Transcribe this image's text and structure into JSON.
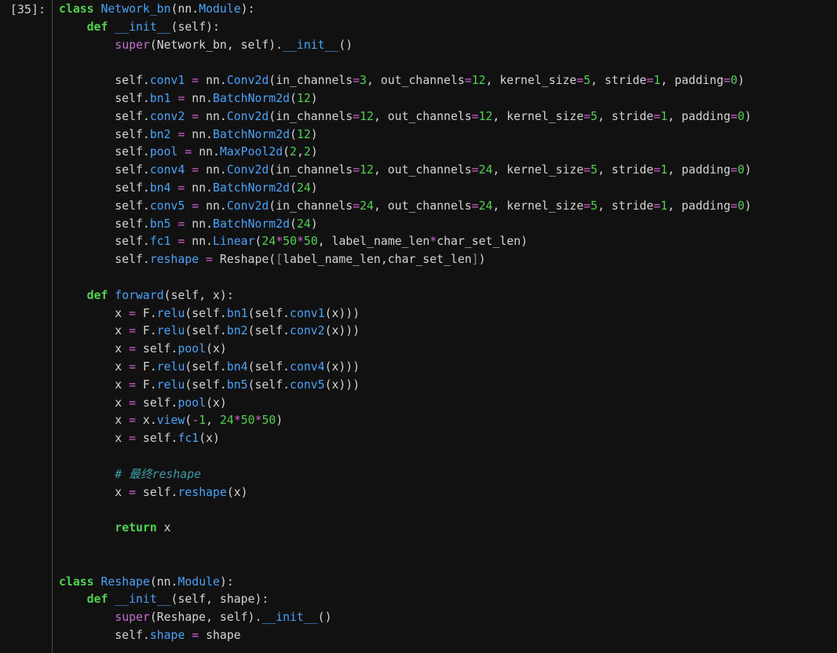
{
  "cell": {
    "prompt": "[35]:"
  },
  "code_lines": [
    [
      [
        "kw",
        "class"
      ],
      [
        "id",
        " "
      ],
      [
        "fn",
        "Network_bn"
      ],
      [
        "id",
        "(nn."
      ],
      [
        "fn",
        "Module"
      ],
      [
        "id",
        "):"
      ]
    ],
    [
      [
        "id",
        "    "
      ],
      [
        "kw",
        "def"
      ],
      [
        "id",
        " "
      ],
      [
        "fn",
        "__init__"
      ],
      [
        "id",
        "(self):"
      ]
    ],
    [
      [
        "id",
        "        "
      ],
      [
        "bi",
        "super"
      ],
      [
        "id",
        "(Network_bn, self)."
      ],
      [
        "fn",
        "__init__"
      ],
      [
        "id",
        "()"
      ]
    ],
    [],
    [
      [
        "id",
        "        self."
      ],
      [
        "fn",
        "conv1"
      ],
      [
        "id",
        " "
      ],
      [
        "op",
        "="
      ],
      [
        "id",
        " nn."
      ],
      [
        "fn",
        "Conv2d"
      ],
      [
        "id",
        "(in_channels"
      ],
      [
        "op",
        "="
      ],
      [
        "num",
        "3"
      ],
      [
        "id",
        ", out_channels"
      ],
      [
        "op",
        "="
      ],
      [
        "num",
        "12"
      ],
      [
        "id",
        ", kernel_size"
      ],
      [
        "op",
        "="
      ],
      [
        "num",
        "5"
      ],
      [
        "id",
        ", stride"
      ],
      [
        "op",
        "="
      ],
      [
        "num",
        "1"
      ],
      [
        "id",
        ", padding"
      ],
      [
        "op",
        "="
      ],
      [
        "num",
        "0"
      ],
      [
        "id",
        ")"
      ]
    ],
    [
      [
        "id",
        "        self."
      ],
      [
        "fn",
        "bn1"
      ],
      [
        "id",
        " "
      ],
      [
        "op",
        "="
      ],
      [
        "id",
        " nn."
      ],
      [
        "fn",
        "BatchNorm2d"
      ],
      [
        "id",
        "("
      ],
      [
        "num",
        "12"
      ],
      [
        "id",
        ")"
      ]
    ],
    [
      [
        "id",
        "        self."
      ],
      [
        "fn",
        "conv2"
      ],
      [
        "id",
        " "
      ],
      [
        "op",
        "="
      ],
      [
        "id",
        " nn."
      ],
      [
        "fn",
        "Conv2d"
      ],
      [
        "id",
        "(in_channels"
      ],
      [
        "op",
        "="
      ],
      [
        "num",
        "12"
      ],
      [
        "id",
        ", out_channels"
      ],
      [
        "op",
        "="
      ],
      [
        "num",
        "12"
      ],
      [
        "id",
        ", kernel_size"
      ],
      [
        "op",
        "="
      ],
      [
        "num",
        "5"
      ],
      [
        "id",
        ", stride"
      ],
      [
        "op",
        "="
      ],
      [
        "num",
        "1"
      ],
      [
        "id",
        ", padding"
      ],
      [
        "op",
        "="
      ],
      [
        "num",
        "0"
      ],
      [
        "id",
        ")"
      ]
    ],
    [
      [
        "id",
        "        self."
      ],
      [
        "fn",
        "bn2"
      ],
      [
        "id",
        " "
      ],
      [
        "op",
        "="
      ],
      [
        "id",
        " nn."
      ],
      [
        "fn",
        "BatchNorm2d"
      ],
      [
        "id",
        "("
      ],
      [
        "num",
        "12"
      ],
      [
        "id",
        ")"
      ]
    ],
    [
      [
        "id",
        "        self."
      ],
      [
        "fn",
        "pool"
      ],
      [
        "id",
        " "
      ],
      [
        "op",
        "="
      ],
      [
        "id",
        " nn."
      ],
      [
        "fn",
        "MaxPool2d"
      ],
      [
        "id",
        "("
      ],
      [
        "num",
        "2"
      ],
      [
        "id",
        ","
      ],
      [
        "num",
        "2"
      ],
      [
        "id",
        ")"
      ]
    ],
    [
      [
        "id",
        "        self."
      ],
      [
        "fn",
        "conv4"
      ],
      [
        "id",
        " "
      ],
      [
        "op",
        "="
      ],
      [
        "id",
        " nn."
      ],
      [
        "fn",
        "Conv2d"
      ],
      [
        "id",
        "(in_channels"
      ],
      [
        "op",
        "="
      ],
      [
        "num",
        "12"
      ],
      [
        "id",
        ", out_channels"
      ],
      [
        "op",
        "="
      ],
      [
        "num",
        "24"
      ],
      [
        "id",
        ", kernel_size"
      ],
      [
        "op",
        "="
      ],
      [
        "num",
        "5"
      ],
      [
        "id",
        ", stride"
      ],
      [
        "op",
        "="
      ],
      [
        "num",
        "1"
      ],
      [
        "id",
        ", padding"
      ],
      [
        "op",
        "="
      ],
      [
        "num",
        "0"
      ],
      [
        "id",
        ")"
      ]
    ],
    [
      [
        "id",
        "        self."
      ],
      [
        "fn",
        "bn4"
      ],
      [
        "id",
        " "
      ],
      [
        "op",
        "="
      ],
      [
        "id",
        " nn."
      ],
      [
        "fn",
        "BatchNorm2d"
      ],
      [
        "id",
        "("
      ],
      [
        "num",
        "24"
      ],
      [
        "id",
        ")"
      ]
    ],
    [
      [
        "id",
        "        self."
      ],
      [
        "fn",
        "conv5"
      ],
      [
        "id",
        " "
      ],
      [
        "op",
        "="
      ],
      [
        "id",
        " nn."
      ],
      [
        "fn",
        "Conv2d"
      ],
      [
        "id",
        "(in_channels"
      ],
      [
        "op",
        "="
      ],
      [
        "num",
        "24"
      ],
      [
        "id",
        ", out_channels"
      ],
      [
        "op",
        "="
      ],
      [
        "num",
        "24"
      ],
      [
        "id",
        ", kernel_size"
      ],
      [
        "op",
        "="
      ],
      [
        "num",
        "5"
      ],
      [
        "id",
        ", stride"
      ],
      [
        "op",
        "="
      ],
      [
        "num",
        "1"
      ],
      [
        "id",
        ", padding"
      ],
      [
        "op",
        "="
      ],
      [
        "num",
        "0"
      ],
      [
        "id",
        ")"
      ]
    ],
    [
      [
        "id",
        "        self."
      ],
      [
        "fn",
        "bn5"
      ],
      [
        "id",
        " "
      ],
      [
        "op",
        "="
      ],
      [
        "id",
        " nn."
      ],
      [
        "fn",
        "BatchNorm2d"
      ],
      [
        "id",
        "("
      ],
      [
        "num",
        "24"
      ],
      [
        "id",
        ")"
      ]
    ],
    [
      [
        "id",
        "        self."
      ],
      [
        "fn",
        "fc1"
      ],
      [
        "id",
        " "
      ],
      [
        "op",
        "="
      ],
      [
        "id",
        " nn."
      ],
      [
        "fn",
        "Linear"
      ],
      [
        "id",
        "("
      ],
      [
        "num",
        "24"
      ],
      [
        "op",
        "*"
      ],
      [
        "num",
        "50"
      ],
      [
        "op",
        "*"
      ],
      [
        "num",
        "50"
      ],
      [
        "id",
        ", label_name_len"
      ],
      [
        "op",
        "*"
      ],
      [
        "id",
        "char_set_len)"
      ]
    ],
    [
      [
        "id",
        "        self."
      ],
      [
        "fn",
        "reshape"
      ],
      [
        "id",
        " "
      ],
      [
        "op",
        "="
      ],
      [
        "id",
        " Reshape("
      ],
      [
        "brk",
        "["
      ],
      [
        "id",
        "label_name_len,char_set_len"
      ],
      [
        "brk",
        "]"
      ],
      [
        "id",
        ")"
      ]
    ],
    [],
    [
      [
        "id",
        "    "
      ],
      [
        "kw",
        "def"
      ],
      [
        "id",
        " "
      ],
      [
        "fn",
        "forward"
      ],
      [
        "id",
        "(self, x):"
      ]
    ],
    [
      [
        "id",
        "        x "
      ],
      [
        "op",
        "="
      ],
      [
        "id",
        " F."
      ],
      [
        "fn",
        "relu"
      ],
      [
        "id",
        "(self."
      ],
      [
        "fn",
        "bn1"
      ],
      [
        "id",
        "(self."
      ],
      [
        "fn",
        "conv1"
      ],
      [
        "id",
        "(x)))"
      ]
    ],
    [
      [
        "id",
        "        x "
      ],
      [
        "op",
        "="
      ],
      [
        "id",
        " F."
      ],
      [
        "fn",
        "relu"
      ],
      [
        "id",
        "(self."
      ],
      [
        "fn",
        "bn2"
      ],
      [
        "id",
        "(self."
      ],
      [
        "fn",
        "conv2"
      ],
      [
        "id",
        "(x)))"
      ]
    ],
    [
      [
        "id",
        "        x "
      ],
      [
        "op",
        "="
      ],
      [
        "id",
        " self."
      ],
      [
        "fn",
        "pool"
      ],
      [
        "id",
        "(x)"
      ]
    ],
    [
      [
        "id",
        "        x "
      ],
      [
        "op",
        "="
      ],
      [
        "id",
        " F."
      ],
      [
        "fn",
        "relu"
      ],
      [
        "id",
        "(self."
      ],
      [
        "fn",
        "bn4"
      ],
      [
        "id",
        "(self."
      ],
      [
        "fn",
        "conv4"
      ],
      [
        "id",
        "(x)))"
      ]
    ],
    [
      [
        "id",
        "        x "
      ],
      [
        "op",
        "="
      ],
      [
        "id",
        " F."
      ],
      [
        "fn",
        "relu"
      ],
      [
        "id",
        "(self."
      ],
      [
        "fn",
        "bn5"
      ],
      [
        "id",
        "(self."
      ],
      [
        "fn",
        "conv5"
      ],
      [
        "id",
        "(x)))"
      ]
    ],
    [
      [
        "id",
        "        x "
      ],
      [
        "op",
        "="
      ],
      [
        "id",
        " self."
      ],
      [
        "fn",
        "pool"
      ],
      [
        "id",
        "(x)"
      ]
    ],
    [
      [
        "id",
        "        x "
      ],
      [
        "op",
        "="
      ],
      [
        "id",
        " x."
      ],
      [
        "fn",
        "view"
      ],
      [
        "id",
        "("
      ],
      [
        "op",
        "-"
      ],
      [
        "num",
        "1"
      ],
      [
        "id",
        ", "
      ],
      [
        "num",
        "24"
      ],
      [
        "op",
        "*"
      ],
      [
        "num",
        "50"
      ],
      [
        "op",
        "*"
      ],
      [
        "num",
        "50"
      ],
      [
        "id",
        ")"
      ]
    ],
    [
      [
        "id",
        "        x "
      ],
      [
        "op",
        "="
      ],
      [
        "id",
        " self."
      ],
      [
        "fn",
        "fc1"
      ],
      [
        "id",
        "(x)"
      ]
    ],
    [],
    [
      [
        "id",
        "        "
      ],
      [
        "cm",
        "# 最终reshape"
      ]
    ],
    [
      [
        "id",
        "        x "
      ],
      [
        "op",
        "="
      ],
      [
        "id",
        " self."
      ],
      [
        "fn",
        "reshape"
      ],
      [
        "id",
        "(x)"
      ]
    ],
    [],
    [
      [
        "id",
        "        "
      ],
      [
        "kw",
        "return"
      ],
      [
        "id",
        " x"
      ]
    ],
    [],
    [],
    [
      [
        "kw",
        "class"
      ],
      [
        "id",
        " "
      ],
      [
        "fn",
        "Reshape"
      ],
      [
        "id",
        "(nn."
      ],
      [
        "fn",
        "Module"
      ],
      [
        "id",
        "):"
      ]
    ],
    [
      [
        "id",
        "    "
      ],
      [
        "kw",
        "def"
      ],
      [
        "id",
        " "
      ],
      [
        "fn",
        "__init__"
      ],
      [
        "id",
        "(self, shape):"
      ]
    ],
    [
      [
        "id",
        "        "
      ],
      [
        "bi",
        "super"
      ],
      [
        "id",
        "(Reshape, self)."
      ],
      [
        "fn",
        "__init__"
      ],
      [
        "id",
        "()"
      ]
    ],
    [
      [
        "id",
        "        self."
      ],
      [
        "fn",
        "shape"
      ],
      [
        "id",
        " "
      ],
      [
        "op",
        "="
      ],
      [
        "id",
        " shape"
      ]
    ]
  ]
}
